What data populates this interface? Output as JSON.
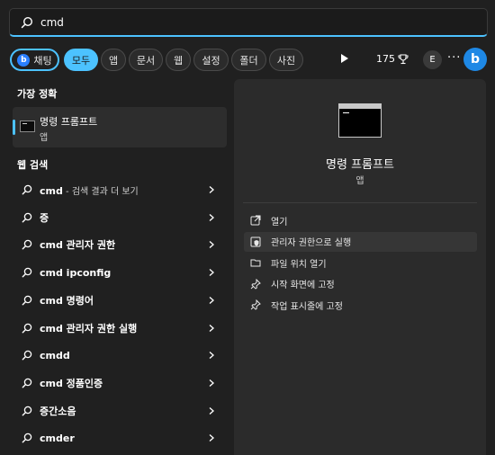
{
  "search": {
    "value": "cmd"
  },
  "filters": {
    "chat_label": "채팅",
    "tabs": [
      "모두",
      "앱",
      "문서",
      "웹",
      "설정",
      "폴더",
      "사진"
    ],
    "points": "175",
    "avatar_letter": "E",
    "more": "···"
  },
  "best_match": {
    "header": "가장 정확",
    "title": "명령 프롬프트",
    "subtitle": "앱"
  },
  "web_search": {
    "header": "웹 검색",
    "items": [
      {
        "bold": "cmd",
        "rest": " - 검색 결과 더 보기"
      },
      {
        "bold": "증",
        "rest": ""
      },
      {
        "bold": "cmd 관리자 권한",
        "rest": ""
      },
      {
        "bold": "cmd ipconfig",
        "rest": ""
      },
      {
        "bold": "cmd 명령어",
        "rest": ""
      },
      {
        "bold": "cmd 관리자 권한 실행",
        "rest": ""
      },
      {
        "bold": "cmdd",
        "rest": ""
      },
      {
        "bold": "cmd 정품인증",
        "rest": ""
      },
      {
        "bold": "증간소음",
        "rest": ""
      },
      {
        "bold": "cmder",
        "rest": ""
      }
    ]
  },
  "detail": {
    "title": "명령 프롬프트",
    "subtitle": "앱",
    "actions": [
      {
        "label": "열기",
        "icon": "open-icon"
      },
      {
        "label": "관리자 권한으로 실행",
        "icon": "admin-shield-icon"
      },
      {
        "label": "파일 위치 열기",
        "icon": "folder-icon"
      },
      {
        "label": "시작 화면에 고정",
        "icon": "pin-icon"
      },
      {
        "label": "작업 표시줄에 고정",
        "icon": "pin-icon"
      }
    ]
  },
  "colors": {
    "accent": "#4cc2ff",
    "background": "#202020",
    "panel": "#2b2b2b"
  }
}
